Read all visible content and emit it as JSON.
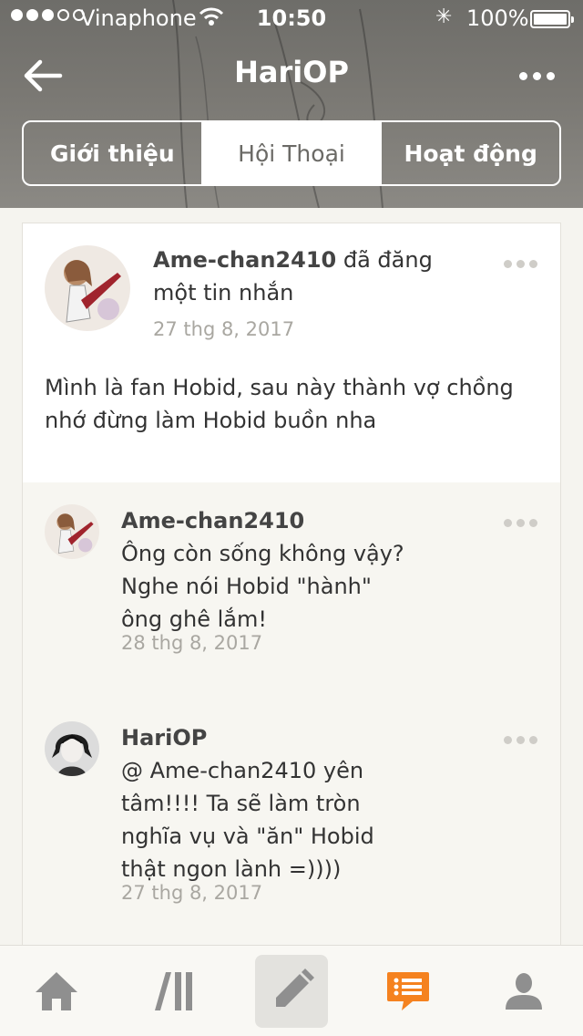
{
  "status_bar": {
    "carrier": "Vinaphone",
    "time": "10:50",
    "battery": "100%"
  },
  "nav": {
    "title": "HariOP",
    "back_icon": "arrow-left-icon",
    "more_icon": "more-horizontal-icon"
  },
  "tabs": [
    {
      "label": "Giới thiệu",
      "active": false
    },
    {
      "label": "Hội Thoại",
      "active": true
    },
    {
      "label": "Hoạt động",
      "active": false
    }
  ],
  "post": {
    "author": "Ame-chan2410",
    "action": " đã đăng",
    "action_line2": "một tin nhắn",
    "date": "27 thg 8, 2017",
    "body_line1": "Mình là fan Hobid, sau này thành vợ chồng",
    "body_line2": "nhớ đừng làm Hobid buồn nha"
  },
  "replies": [
    {
      "author": "Ame-chan2410",
      "lines": [
        "Ông còn sống không vậy?",
        "Nghe nói Hobid \"hành\"",
        "ông ghê lắm!"
      ],
      "date": "28 thg 8, 2017"
    },
    {
      "author": "HariOP",
      "lines": [
        "@ Ame-chan2410  yên",
        "tâm!!!! Ta sẽ làm tròn",
        "nghĩa vụ và \"ăn\" Hobid",
        "thật ngon lành =))))"
      ],
      "date": "27 thg 8, 2017"
    }
  ],
  "tabbar": {
    "items": [
      "home-icon",
      "forums-icon",
      "compose-icon",
      "conversations-icon",
      "profile-icon"
    ],
    "active": "conversations-icon",
    "accent": "#f5821f",
    "inactive": "#8f8f8f"
  }
}
